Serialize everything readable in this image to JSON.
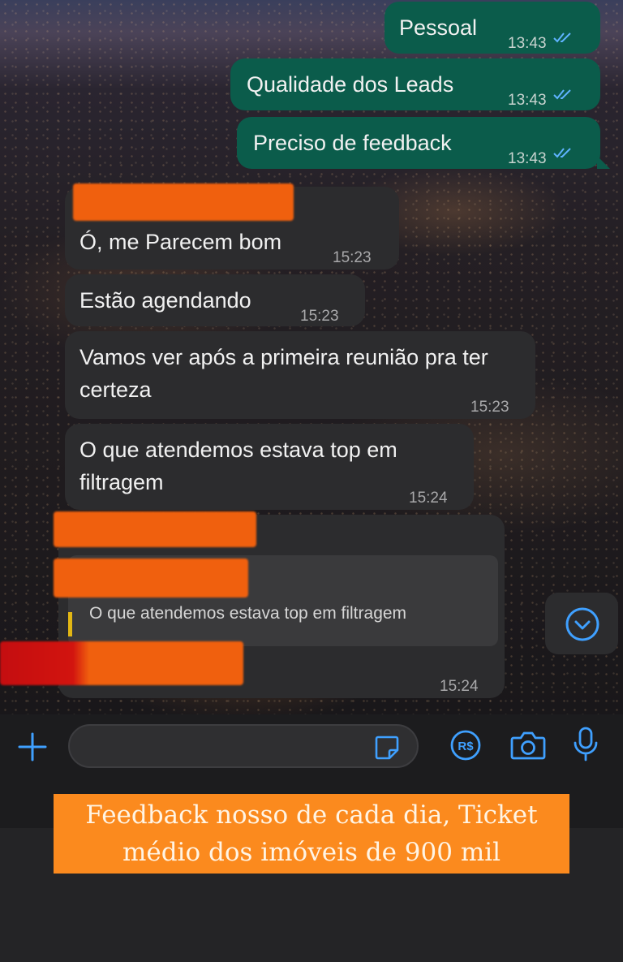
{
  "messages_out": [
    {
      "text": "Pessoal",
      "time": "13:43"
    },
    {
      "text": "Qualidade dos Leads",
      "time": "13:43"
    },
    {
      "text": "Preciso de feedback",
      "time": "13:43"
    }
  ],
  "messages_in": [
    {
      "text": "Ó, me Parecem bom",
      "time": "15:23"
    },
    {
      "text": "Estão agendando",
      "time": "15:23"
    },
    {
      "text": "Vamos ver após a primeira reunião pra ter certeza",
      "time": "15:23"
    },
    {
      "text": "O que atendemos estava top em filtragem",
      "time": "15:24"
    }
  ],
  "reply": {
    "quoted_text": "O que atendemos estava top em filtragem",
    "time": "15:24"
  },
  "input_bar": {
    "icons": [
      "plus-icon",
      "sticker-icon",
      "payment-icon",
      "camera-icon",
      "microphone-icon"
    ],
    "message_value": ""
  },
  "caption": {
    "text": "Feedback nosso de cada dia, Ticket médio dos imóveis de 900 mil"
  },
  "colors": {
    "outgoing_bubble": "#0b5c4b",
    "incoming_bubble": "#2c2c2e",
    "accent_blue": "#3fa0ff",
    "redaction": "#f0600e",
    "caption_bg": "#fb8a1e"
  }
}
